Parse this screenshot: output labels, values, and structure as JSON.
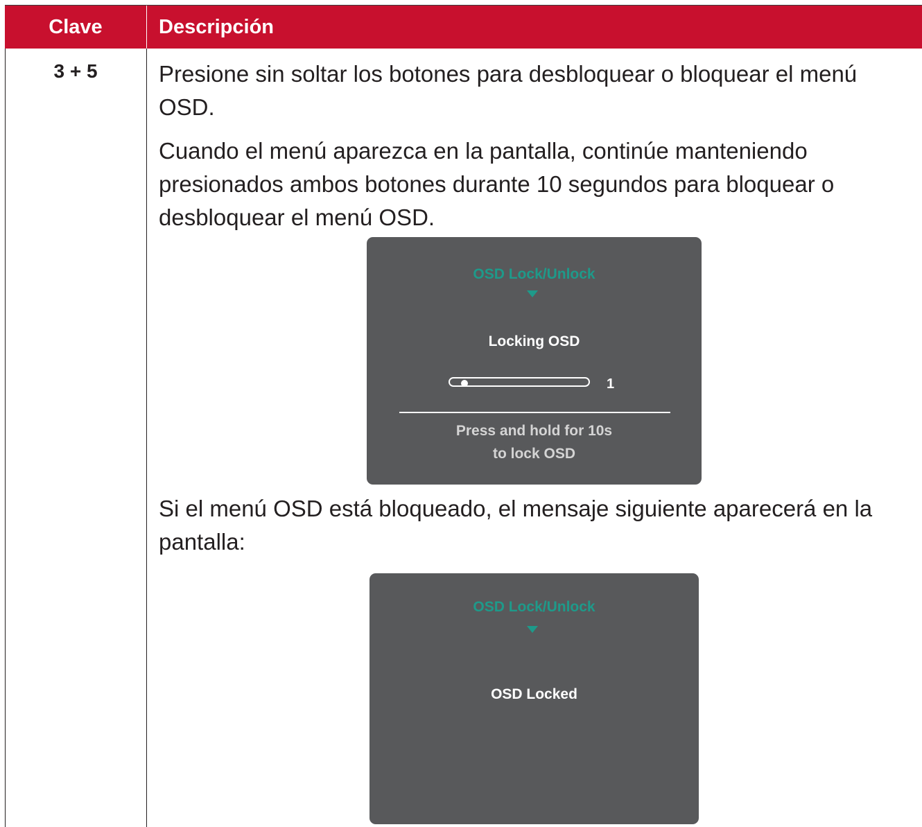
{
  "table": {
    "header": {
      "key": "Clave",
      "description": "Descripción"
    },
    "row": {
      "key": "3 + 5",
      "paragraphs": [
        "Presione sin soltar los botones para desbloquear o bloquear el menú OSD.",
        "Cuando el menú aparezca en la pantalla, continúe manteniendo presionados ambos botones durante 10 segundos para bloquear o desbloquear el menú OSD.",
        "Si el menú OSD está bloqueado, el mensaje siguiente aparecerá en la pantalla:"
      ]
    }
  },
  "osd_locking": {
    "title": "OSD Lock/Unlock",
    "status": "Locking OSD",
    "progress_count": "1",
    "hint_line1": "Press and hold for 10s",
    "hint_line2": "to lock OSD"
  },
  "osd_locked": {
    "title": "OSD Lock/Unlock",
    "status": "OSD Locked"
  },
  "colors": {
    "header_bg": "#c8102e",
    "osd_bg": "#58595b",
    "osd_accent": "#1e9a8a"
  },
  "icons": [
    "down-triangle-icon",
    "slider-knob-icon"
  ]
}
